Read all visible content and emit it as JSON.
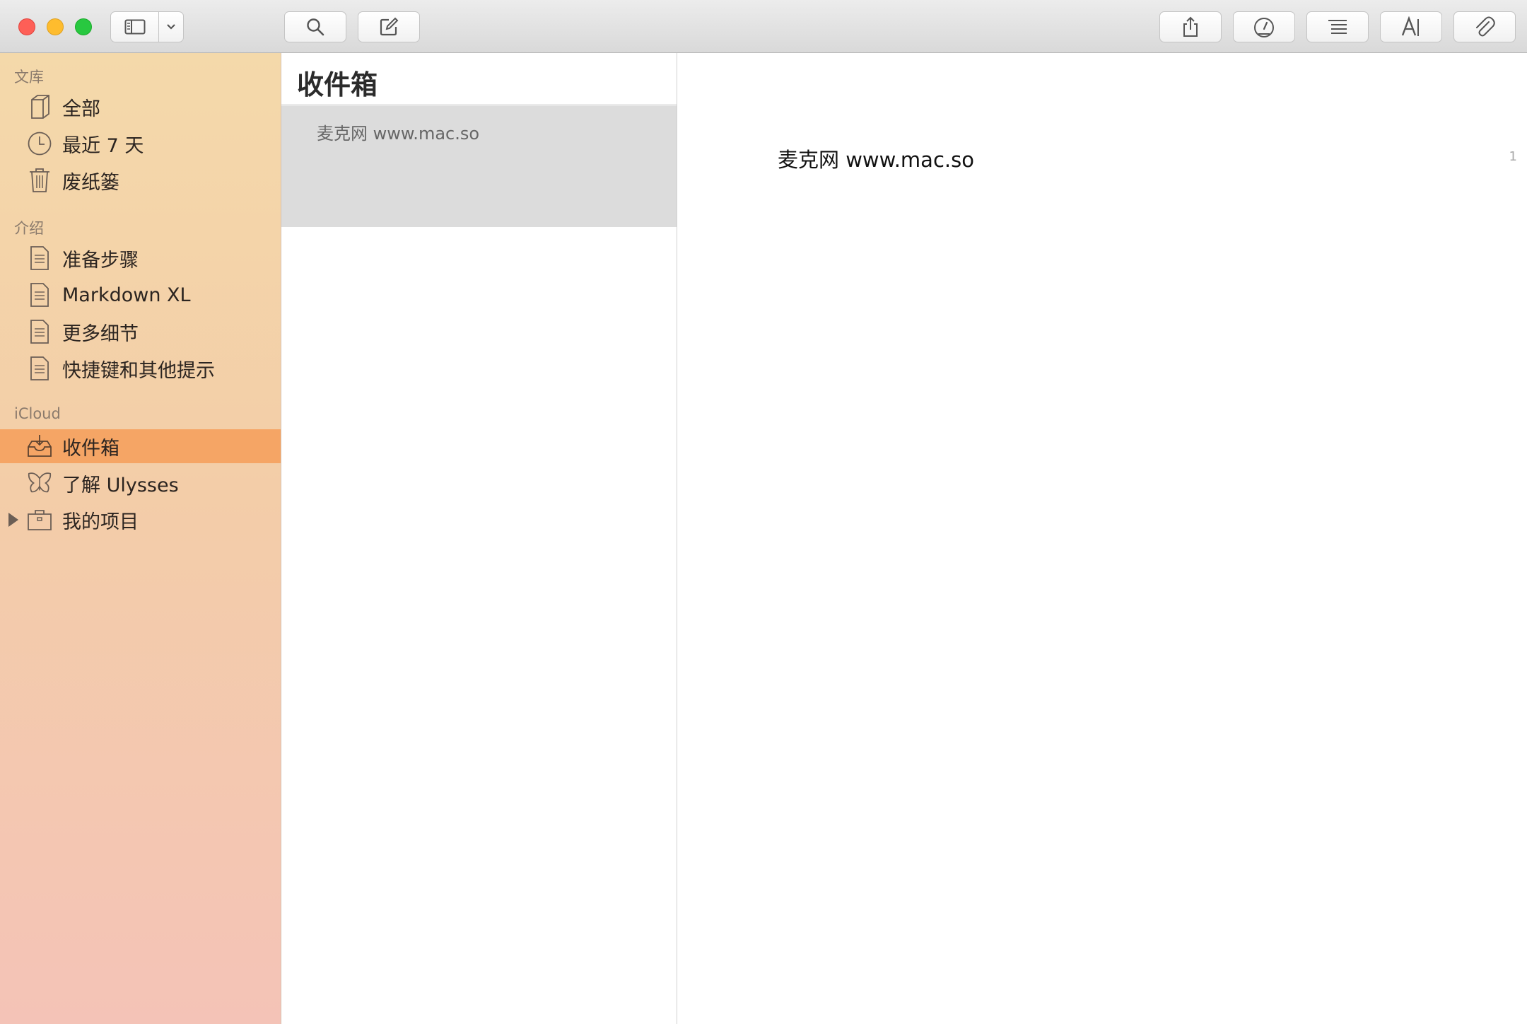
{
  "toolbar": {
    "buttons": [
      "search",
      "compose",
      "share",
      "dashboard",
      "list",
      "typography",
      "attachment"
    ]
  },
  "sidebar": {
    "sections": [
      {
        "label": "文库",
        "items": [
          {
            "label": "全部",
            "icon": "book-icon"
          },
          {
            "label": "最近 7 天",
            "icon": "clock-icon"
          },
          {
            "label": "废纸篓",
            "icon": "trash-icon"
          }
        ]
      },
      {
        "label": "介绍",
        "items": [
          {
            "label": "准备步骤",
            "icon": "document-icon"
          },
          {
            "label": "Markdown XL",
            "icon": "document-icon"
          },
          {
            "label": "更多细节",
            "icon": "document-icon"
          },
          {
            "label": "快捷键和其他提示",
            "icon": "document-icon"
          }
        ]
      },
      {
        "label": "iCloud",
        "items": [
          {
            "label": "收件箱",
            "icon": "inbox-icon",
            "selected": true
          },
          {
            "label": "了解 Ulysses",
            "icon": "butterfly-icon"
          },
          {
            "label": "我的项目",
            "icon": "folder-icon",
            "expandable": true
          }
        ]
      }
    ]
  },
  "sheetlist": {
    "title": "收件箱",
    "sheets": [
      {
        "preview": "麦克网 www.mac.so"
      }
    ]
  },
  "editor": {
    "text": "麦克网 www.mac.so",
    "line_number": "1"
  },
  "colors": {
    "selection": "#f5a565",
    "sidebar_top": "#f4d9aa",
    "sidebar_bottom": "#f4c3b7"
  }
}
